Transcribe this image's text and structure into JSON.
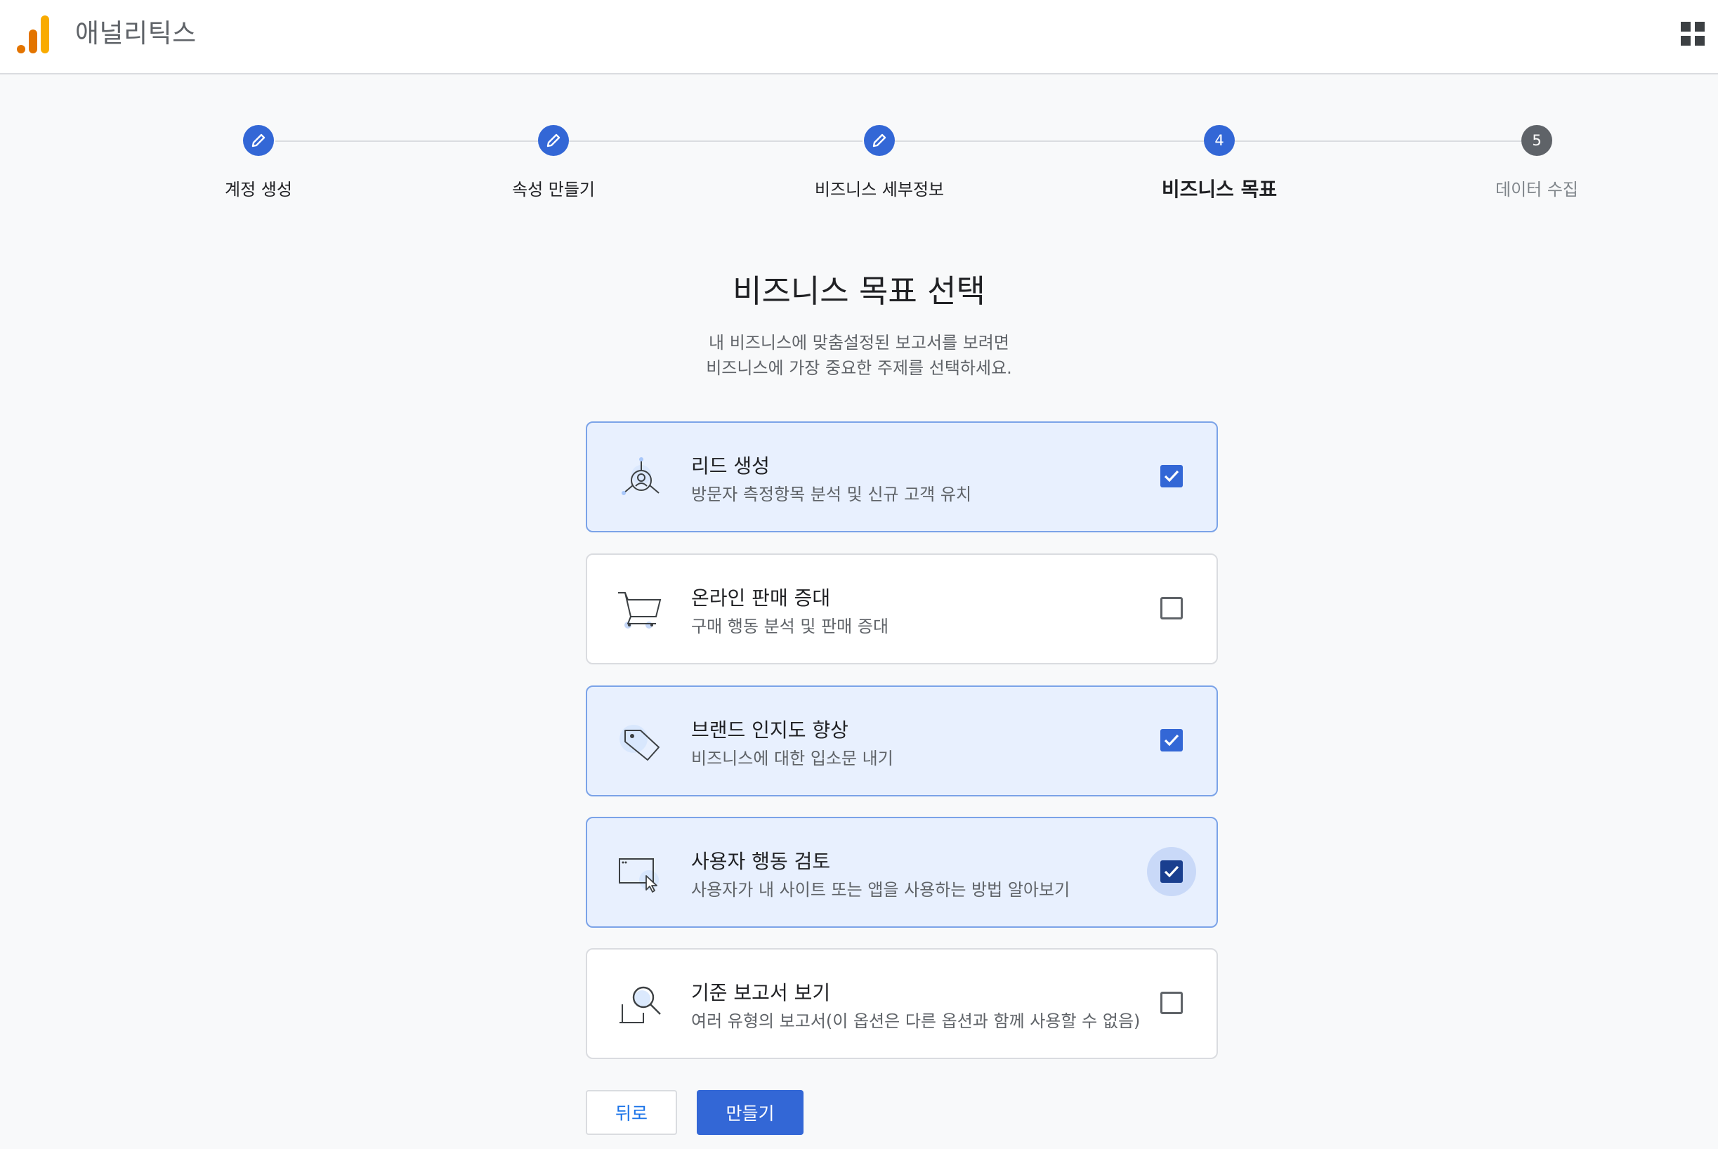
{
  "app": {
    "title": "애널리틱스"
  },
  "stepper": {
    "steps": [
      {
        "label": "계정 생성",
        "state": "done",
        "icon": "pencil-icon"
      },
      {
        "label": "속성 만들기",
        "state": "done",
        "icon": "pencil-icon"
      },
      {
        "label": "비즈니스 세부정보",
        "state": "done",
        "icon": "pencil-icon"
      },
      {
        "label": "비즈니스 목표",
        "number": "4",
        "state": "active"
      },
      {
        "label": "데이터 수집",
        "number": "5",
        "state": "todo"
      }
    ]
  },
  "main": {
    "heading": "비즈니스 목표 선택",
    "subtext_line1": "내 비즈니스에 맞춤설정된 보고서를 보려면",
    "subtext_line2": "비즈니스에 가장 중요한 주제를 선택하세요."
  },
  "options": [
    {
      "title": "리드 생성",
      "desc": "방문자 측정항목 분석 및 신규 고객 유치",
      "checked": true,
      "icon": "lead-network-icon"
    },
    {
      "title": "온라인 판매 증대",
      "desc": "구매 행동 분석 및 판매 증대",
      "checked": false,
      "icon": "shopping-cart-icon"
    },
    {
      "title": "브랜드 인지도 향상",
      "desc": "비즈니스에 대한 입소문 내기",
      "checked": true,
      "icon": "price-tag-icon"
    },
    {
      "title": "사용자 행동 검토",
      "desc": "사용자가 내 사이트 또는 앱을 사용하는 방법 알아보기",
      "checked": true,
      "focused": true,
      "icon": "browser-cursor-icon"
    },
    {
      "title": "기준 보고서 보기",
      "desc": "여러 유형의 보고서(이 옵션은 다른 옵션과 함께 사용할 수 없음)",
      "checked": false,
      "icon": "report-magnifier-icon"
    }
  ],
  "actions": {
    "back_label": "뒤로",
    "create_label": "만들기"
  },
  "colors": {
    "accent": "#3367d6",
    "selected_bg": "#e8f0fe",
    "logo_orange": "#f9ab00",
    "logo_dark_orange": "#e37400"
  }
}
